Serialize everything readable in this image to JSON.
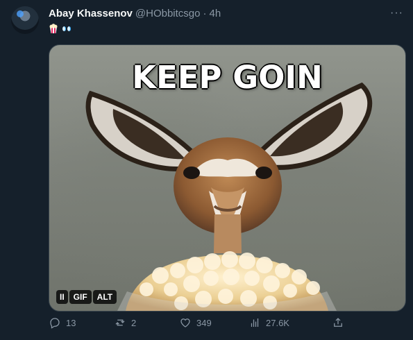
{
  "tweet": {
    "author_name": "Abay Khassenov",
    "author_handle": "@HObbitcsgo",
    "separator": "·",
    "time": "4h",
    "more_label": "···",
    "emoji_icons": [
      "popcorn-icon",
      "eyes-icon"
    ],
    "media": {
      "caption_text": "KEEP GOIN",
      "badges": {
        "pause": "II",
        "gif": "GIF",
        "alt": "ALT"
      }
    },
    "actions": {
      "replies": "13",
      "retweets": "2",
      "likes": "349",
      "views": "27.6K"
    }
  }
}
